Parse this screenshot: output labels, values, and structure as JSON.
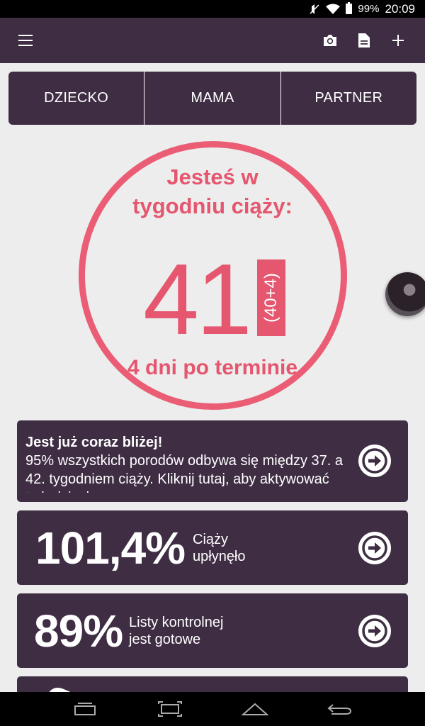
{
  "status_bar": {
    "battery": "99%",
    "time": "20:09",
    "icons": [
      "mute-icon",
      "wifi-icon",
      "battery-icon"
    ]
  },
  "app_bar": {
    "icons": [
      "menu-icon",
      "camera-icon",
      "document-icon",
      "plus-icon"
    ]
  },
  "tabs": [
    {
      "label": "DZIECKO"
    },
    {
      "label": "MAMA"
    },
    {
      "label": "PARTNER"
    }
  ],
  "week": {
    "title": "Jesteś w tygodniu ciąży:",
    "number": "41",
    "badge": "(40+4)",
    "subtitle": "4 dni po terminie"
  },
  "cards": {
    "info": {
      "title": "Jest już coraz bliżej!",
      "text": "95% wszystkich porodów odbywa się między 37. a 42. tygodniem ciąży. Kliknij tutaj, aby aktywować tryb dziecka"
    },
    "progress": {
      "value": "101,4%",
      "label_line1": "Ciąży",
      "label_line2": "upłynęło"
    },
    "checklist": {
      "value": "89%",
      "label_line1": "Listy kontrolnej",
      "label_line2": "jest gotowe"
    }
  },
  "nav_bar": {
    "icons": [
      "recent-apps-icon",
      "screenshot-icon",
      "home-icon",
      "back-icon"
    ]
  },
  "colors": {
    "primary": "#3e2d43",
    "accent": "#e5566f",
    "background": "#ededed"
  }
}
